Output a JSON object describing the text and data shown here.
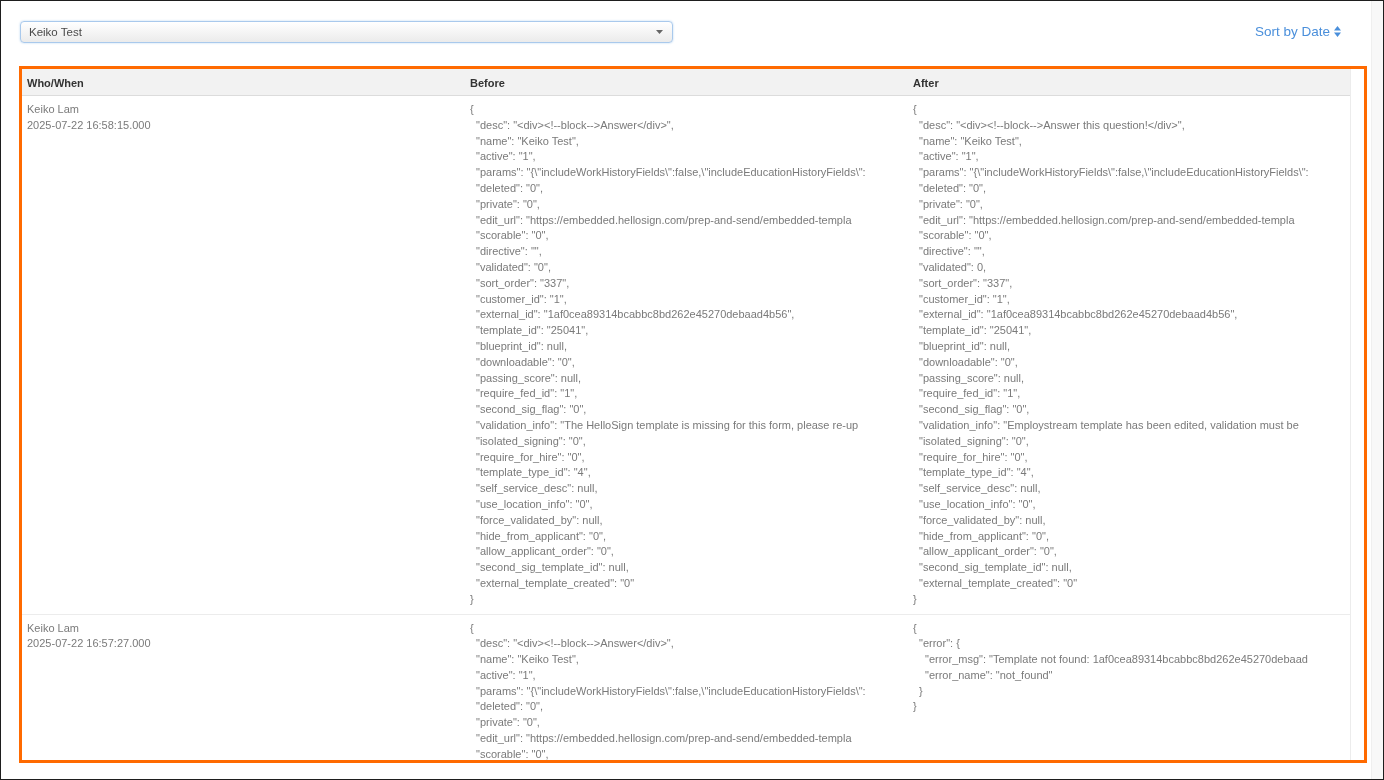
{
  "filter_select": {
    "value": "Keiko Test"
  },
  "sort_link": {
    "label": "Sort by Date"
  },
  "table": {
    "columns": [
      "Who/When",
      "Before",
      "After"
    ],
    "rows": [
      {
        "who": "Keiko Lam",
        "when": "2025-07-22 16:58:15.000",
        "before": [
          {
            "text": "{",
            "children": [
              {
                "text": "\"desc\": \"<div><!--block-->Answer</div>\","
              },
              {
                "text": "\"name\": \"Keiko Test\","
              },
              {
                "text": "\"active\": \"1\","
              },
              {
                "text": "\"params\": \"{\\\"includeWorkHistoryFields\\\":false,\\\"includeEducationHistoryFields\\\":"
              },
              {
                "text": "\"deleted\": \"0\","
              },
              {
                "text": "\"private\": \"0\","
              },
              {
                "text": "\"edit_url\": \"https://embedded.hellosign.com/prep-and-send/embedded-templa"
              },
              {
                "text": "\"scorable\": \"0\","
              },
              {
                "text": "\"directive\": \"\","
              },
              {
                "text": "\"validated\": \"0\","
              },
              {
                "text": "\"sort_order\": \"337\","
              },
              {
                "text": "\"customer_id\": \"1\","
              },
              {
                "text": "\"external_id\": \"1af0cea89314bcabbc8bd262e45270debaad4b56\","
              },
              {
                "text": "\"template_id\": \"25041\","
              },
              {
                "text": "\"blueprint_id\": null,"
              },
              {
                "text": "\"downloadable\": \"0\","
              },
              {
                "text": "\"passing_score\": null,"
              },
              {
                "text": "\"require_fed_id\": \"1\","
              },
              {
                "text": "\"second_sig_flag\": \"0\","
              },
              {
                "text": "\"validation_info\": \"The HelloSign template is missing for this form, please re-up"
              },
              {
                "text": "\"isolated_signing\": \"0\","
              },
              {
                "text": "\"require_for_hire\": \"0\","
              },
              {
                "text": "\"template_type_id\": \"4\","
              },
              {
                "text": "\"self_service_desc\": null,"
              },
              {
                "text": "\"use_location_info\": \"0\","
              },
              {
                "text": "\"force_validated_by\": null,"
              },
              {
                "text": "\"hide_from_applicant\": \"0\","
              },
              {
                "text": "\"allow_applicant_order\": \"0\","
              },
              {
                "text": "\"second_sig_template_id\": null,"
              },
              {
                "text": "\"external_template_created\": \"0\""
              }
            ]
          },
          {
            "text": "}"
          }
        ],
        "after": [
          {
            "text": "{",
            "children": [
              {
                "text": "\"desc\": \"<div><!--block-->Answer this question!</div>\","
              },
              {
                "text": "\"name\": \"Keiko Test\","
              },
              {
                "text": "\"active\": \"1\","
              },
              {
                "text": "\"params\": \"{\\\"includeWorkHistoryFields\\\":false,\\\"includeEducationHistoryFields\\\":"
              },
              {
                "text": "\"deleted\": \"0\","
              },
              {
                "text": "\"private\": \"0\","
              },
              {
                "text": "\"edit_url\": \"https://embedded.hellosign.com/prep-and-send/embedded-templa"
              },
              {
                "text": "\"scorable\": \"0\","
              },
              {
                "text": "\"directive\": \"\","
              },
              {
                "text": "\"validated\": 0,"
              },
              {
                "text": "\"sort_order\": \"337\","
              },
              {
                "text": "\"customer_id\": \"1\","
              },
              {
                "text": "\"external_id\": \"1af0cea89314bcabbc8bd262e45270debaad4b56\","
              },
              {
                "text": "\"template_id\": \"25041\","
              },
              {
                "text": "\"blueprint_id\": null,"
              },
              {
                "text": "\"downloadable\": \"0\","
              },
              {
                "text": "\"passing_score\": null,"
              },
              {
                "text": "\"require_fed_id\": \"1\","
              },
              {
                "text": "\"second_sig_flag\": \"0\","
              },
              {
                "text": "\"validation_info\": \"Employstream template has been edited, validation must be"
              },
              {
                "text": "\"isolated_signing\": \"0\","
              },
              {
                "text": "\"require_for_hire\": \"0\","
              },
              {
                "text": "\"template_type_id\": \"4\","
              },
              {
                "text": "\"self_service_desc\": null,"
              },
              {
                "text": "\"use_location_info\": \"0\","
              },
              {
                "text": "\"force_validated_by\": null,"
              },
              {
                "text": "\"hide_from_applicant\": \"0\","
              },
              {
                "text": "\"allow_applicant_order\": \"0\","
              },
              {
                "text": "\"second_sig_template_id\": null,"
              },
              {
                "text": "\"external_template_created\": \"0\""
              }
            ]
          },
          {
            "text": "}"
          }
        ]
      },
      {
        "who": "Keiko Lam",
        "when": "2025-07-22 16:57:27.000",
        "before": [
          {
            "text": "{",
            "children": [
              {
                "text": "\"desc\": \"<div><!--block-->Answer</div>\","
              },
              {
                "text": "\"name\": \"Keiko Test\","
              },
              {
                "text": "\"active\": \"1\","
              },
              {
                "text": "\"params\": \"{\\\"includeWorkHistoryFields\\\":false,\\\"includeEducationHistoryFields\\\":"
              },
              {
                "text": "\"deleted\": \"0\","
              },
              {
                "text": "\"private\": \"0\","
              },
              {
                "text": "\"edit_url\": \"https://embedded.hellosign.com/prep-and-send/embedded-templa"
              },
              {
                "text": "\"scorable\": \"0\","
              }
            ]
          }
        ],
        "after": [
          {
            "text": "{",
            "children": [
              {
                "text": "\"error\": {",
                "children": [
                  {
                    "text": "\"error_msg\": \"Template not found: 1af0cea89314bcabbc8bd262e45270debaad"
                  },
                  {
                    "text": "\"error_name\": \"not_found\""
                  }
                ]
              },
              {
                "text": "}"
              }
            ]
          },
          {
            "text": "}"
          }
        ]
      }
    ]
  }
}
